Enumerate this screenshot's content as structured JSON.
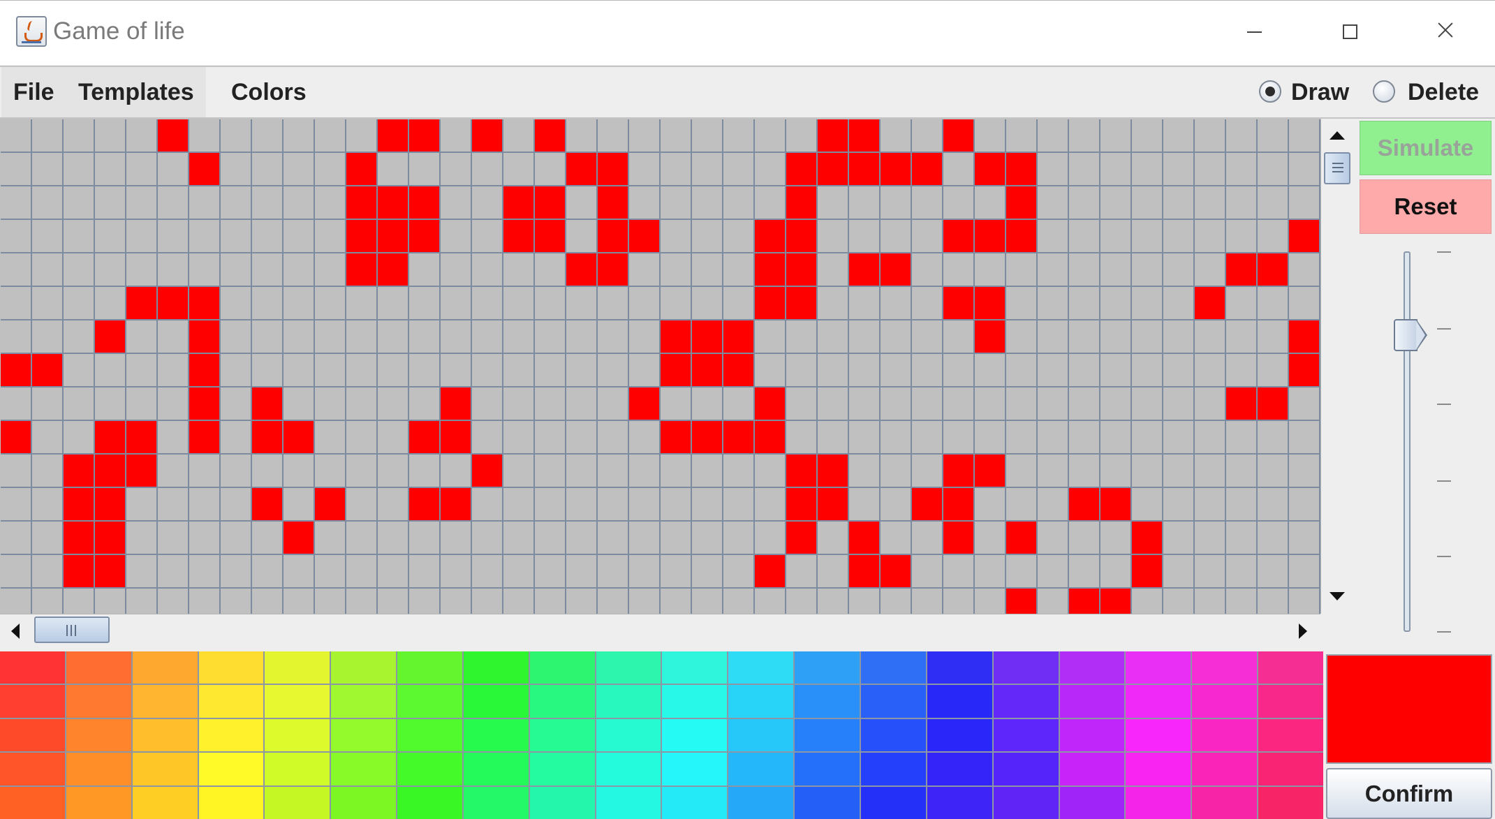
{
  "window": {
    "title": "Game of life",
    "icon": "java-cup-icon"
  },
  "menu": {
    "items": [
      "File",
      "Templates",
      "Colors"
    ]
  },
  "mode": {
    "options": [
      {
        "label": "Draw",
        "checked": true
      },
      {
        "label": "Delete",
        "checked": false
      }
    ]
  },
  "controls": {
    "simulate_label": "Simulate",
    "reset_label": "Reset",
    "simulate_color": "#90f090",
    "reset_color": "#ffaaaa",
    "speed_slider_level": 0.78
  },
  "grid": {
    "columns": 42,
    "rows": 15,
    "alive_color": "#ff0000",
    "dead_color": "#c0c0c0",
    "line_color": "#7d8ba0",
    "alive": [
      [
        0,
        5
      ],
      [
        0,
        12
      ],
      [
        0,
        13
      ],
      [
        0,
        15
      ],
      [
        0,
        17
      ],
      [
        0,
        26
      ],
      [
        0,
        27
      ],
      [
        0,
        30
      ],
      [
        1,
        6
      ],
      [
        1,
        11
      ],
      [
        1,
        18
      ],
      [
        1,
        19
      ],
      [
        1,
        25
      ],
      [
        1,
        26
      ],
      [
        1,
        27
      ],
      [
        1,
        28
      ],
      [
        1,
        29
      ],
      [
        1,
        31
      ],
      [
        1,
        32
      ],
      [
        2,
        11
      ],
      [
        2,
        12
      ],
      [
        2,
        13
      ],
      [
        2,
        16
      ],
      [
        2,
        17
      ],
      [
        2,
        19
      ],
      [
        2,
        25
      ],
      [
        2,
        32
      ],
      [
        3,
        11
      ],
      [
        3,
        12
      ],
      [
        3,
        13
      ],
      [
        3,
        16
      ],
      [
        3,
        17
      ],
      [
        3,
        19
      ],
      [
        3,
        20
      ],
      [
        3,
        24
      ],
      [
        3,
        25
      ],
      [
        3,
        30
      ],
      [
        3,
        31
      ],
      [
        3,
        32
      ],
      [
        3,
        41
      ],
      [
        4,
        11
      ],
      [
        4,
        12
      ],
      [
        4,
        18
      ],
      [
        4,
        19
      ],
      [
        4,
        24
      ],
      [
        4,
        25
      ],
      [
        4,
        27
      ],
      [
        4,
        28
      ],
      [
        4,
        39
      ],
      [
        4,
        40
      ],
      [
        5,
        4
      ],
      [
        5,
        5
      ],
      [
        5,
        6
      ],
      [
        5,
        24
      ],
      [
        5,
        25
      ],
      [
        5,
        30
      ],
      [
        5,
        31
      ],
      [
        5,
        38
      ],
      [
        6,
        3
      ],
      [
        6,
        6
      ],
      [
        6,
        21
      ],
      [
        6,
        22
      ],
      [
        6,
        23
      ],
      [
        6,
        31
      ],
      [
        6,
        41
      ],
      [
        7,
        0
      ],
      [
        7,
        1
      ],
      [
        7,
        6
      ],
      [
        7,
        21
      ],
      [
        7,
        22
      ],
      [
        7,
        23
      ],
      [
        7,
        41
      ],
      [
        8,
        6
      ],
      [
        8,
        8
      ],
      [
        8,
        14
      ],
      [
        8,
        20
      ],
      [
        8,
        24
      ],
      [
        8,
        39
      ],
      [
        8,
        40
      ],
      [
        9,
        0
      ],
      [
        9,
        3
      ],
      [
        9,
        4
      ],
      [
        9,
        6
      ],
      [
        9,
        8
      ],
      [
        9,
        9
      ],
      [
        9,
        13
      ],
      [
        9,
        14
      ],
      [
        9,
        21
      ],
      [
        9,
        22
      ],
      [
        9,
        23
      ],
      [
        9,
        24
      ],
      [
        10,
        2
      ],
      [
        10,
        3
      ],
      [
        10,
        4
      ],
      [
        10,
        15
      ],
      [
        10,
        25
      ],
      [
        10,
        26
      ],
      [
        10,
        30
      ],
      [
        10,
        31
      ],
      [
        11,
        2
      ],
      [
        11,
        3
      ],
      [
        11,
        8
      ],
      [
        11,
        10
      ],
      [
        11,
        13
      ],
      [
        11,
        14
      ],
      [
        11,
        25
      ],
      [
        11,
        26
      ],
      [
        11,
        29
      ],
      [
        11,
        30
      ],
      [
        11,
        34
      ],
      [
        11,
        35
      ],
      [
        12,
        2
      ],
      [
        12,
        3
      ],
      [
        12,
        9
      ],
      [
        12,
        25
      ],
      [
        12,
        27
      ],
      [
        12,
        30
      ],
      [
        12,
        32
      ],
      [
        12,
        36
      ],
      [
        13,
        2
      ],
      [
        13,
        3
      ],
      [
        13,
        24
      ],
      [
        13,
        27
      ],
      [
        13,
        28
      ],
      [
        13,
        36
      ],
      [
        14,
        32
      ],
      [
        14,
        34
      ],
      [
        14,
        35
      ]
    ]
  },
  "palette": {
    "columns": 20,
    "rows": [
      [
        "#ff3333",
        "#ff6e30",
        "#ffa82f",
        "#ffdc30",
        "#e3f52f",
        "#a8f52f",
        "#65f52f",
        "#2ef52e",
        "#2ef570",
        "#2ef5ad",
        "#2ef5dc",
        "#2edcf5",
        "#2ea0f5",
        "#2e6ff5",
        "#2e2ef5",
        "#702ef5",
        "#b02ef5",
        "#e92ef5",
        "#f52ed6",
        "#f52e94"
      ],
      [
        "#ff4030",
        "#ff7a30",
        "#ffb530",
        "#ffe830",
        "#e8f830",
        "#a0f830",
        "#5cf830",
        "#28f838",
        "#28f880",
        "#28f8bd",
        "#28f8e8",
        "#28d4f8",
        "#2890f8",
        "#2860f8",
        "#2828f8",
        "#6428f8",
        "#b828f8",
        "#f028f8",
        "#f828d0",
        "#f8288a"
      ],
      [
        "#ff4a2a",
        "#ff842c",
        "#ffbe2c",
        "#fff22c",
        "#dcfa2c",
        "#94fa2c",
        "#50fa2c",
        "#26fa4c",
        "#26fa92",
        "#26fad0",
        "#26faf4",
        "#26c8fa",
        "#2680fa",
        "#2650fa",
        "#2a26fa",
        "#5e26fa",
        "#c026fa",
        "#f826fa",
        "#fa26c4",
        "#fa2680"
      ],
      [
        "#ff5528",
        "#ff8e28",
        "#ffc628",
        "#fffa28",
        "#d0fa28",
        "#88fa28",
        "#44fa28",
        "#24fa5a",
        "#24faa0",
        "#24fadc",
        "#24f6fa",
        "#24b8fa",
        "#2470fa",
        "#2440fa",
        "#3424fa",
        "#5424fa",
        "#c824fa",
        "#fa24f2",
        "#fa24b8",
        "#fa2474"
      ],
      [
        "#ff6024",
        "#ff9824",
        "#ffce24",
        "#fff424",
        "#c4f724",
        "#7cf724",
        "#38f724",
        "#24f768",
        "#24f7ac",
        "#24f7e2",
        "#24eaf7",
        "#24a8f7",
        "#2460f7",
        "#2430f7",
        "#3e24f7",
        "#6024f7",
        "#a024f7",
        "#f424e8",
        "#f724a8",
        "#f72468"
      ]
    ]
  },
  "color_picker": {
    "selected_color": "#ff0000",
    "confirm_label": "Confirm"
  }
}
